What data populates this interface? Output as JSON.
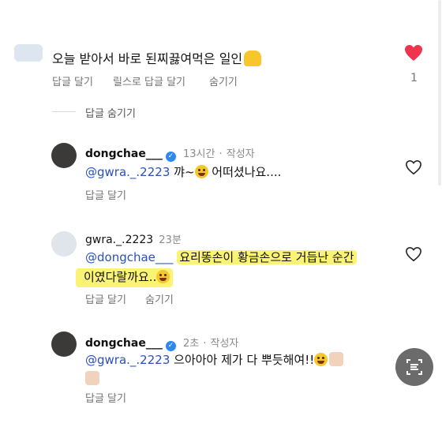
{
  "comment": {
    "text": "오늘 받아서 바로 된찌끓여먹은 일인",
    "emoji": "raising-hands",
    "actions": [
      "답글 달기",
      "릴스로 답글 달기",
      "숨기기"
    ],
    "like_count": "1",
    "liked": true
  },
  "hide_replies_label": "답글 숨기기",
  "replies": [
    {
      "username": "dongchae___",
      "verified": true,
      "time": "13시간",
      "author_tag": "작성자",
      "mention": "@gwra._.2223",
      "text_before": "꺄~",
      "text_after": "어떠셨나요....",
      "actions": [
        "답글 달기"
      ]
    },
    {
      "username": "gwra._.2223",
      "time": "23분",
      "mention": "@dongchae___",
      "text_line1": "요리똥손이 황금손으로 거듭난 순간",
      "text_line2": "이였다랄까요..",
      "actions": [
        "답글 달기",
        "숨기기"
      ]
    },
    {
      "username": "dongchae___",
      "verified": true,
      "time": "2초",
      "author_tag": "작성자",
      "mention": "@gwra._.2223",
      "text": "으아아아 제가 다 뿌듯해여!!",
      "actions": [
        "답글 달기"
      ]
    }
  ],
  "colors": {
    "mention": "#2a4fbd",
    "highlight": "#fbf373",
    "heart": "#f0334f",
    "verified": "#2f88ee"
  }
}
